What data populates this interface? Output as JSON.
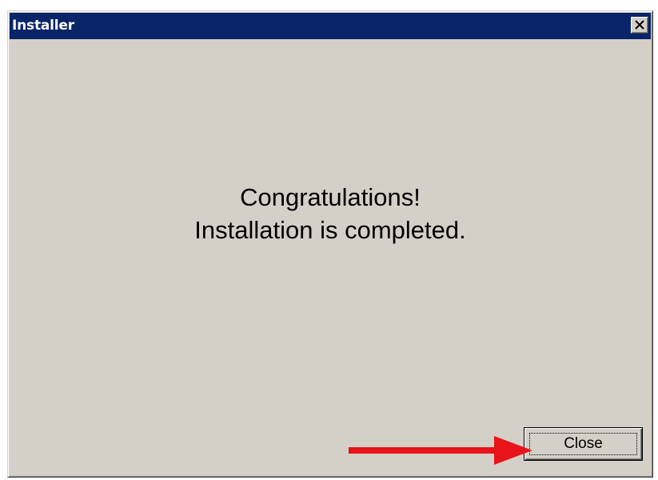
{
  "window": {
    "title": "Installer",
    "close_icon": "close-x-icon"
  },
  "message": {
    "line1": "Congratulations!",
    "line2": "Installation is completed."
  },
  "buttons": {
    "close_label": "Close"
  },
  "annotation": {
    "arrow_icon": "red-arrow-icon",
    "arrow_color": "#e8141a"
  },
  "colors": {
    "titlebar": "#0a246a",
    "window_face": "#d4d0c8"
  }
}
